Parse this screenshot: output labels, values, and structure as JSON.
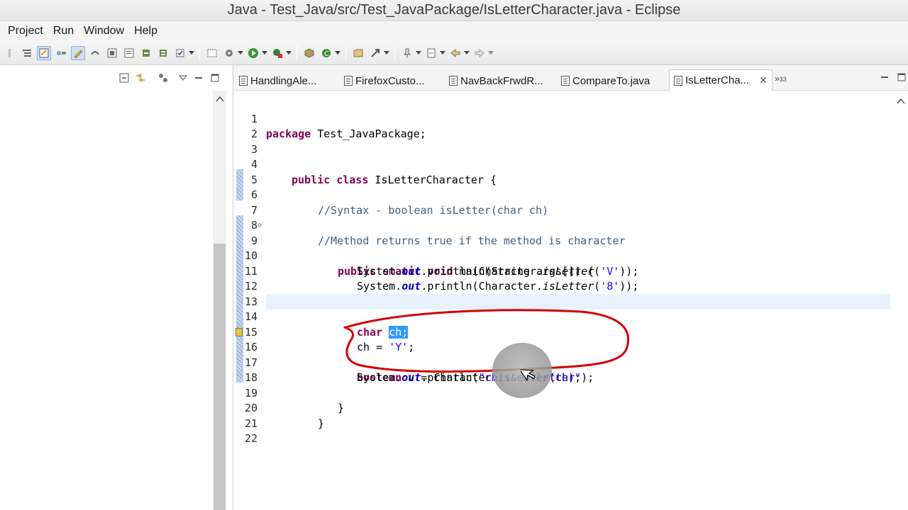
{
  "window": {
    "title": "Java - Test_Java/src/Test_JavaPackage/IsLetterCharacter.java - Eclipse"
  },
  "menu": [
    "Project",
    "Run",
    "Window",
    "Help"
  ],
  "editor": {
    "tabs": [
      {
        "label": "HandlingAle...",
        "active": false
      },
      {
        "label": "FirefoxCusto...",
        "active": false
      },
      {
        "label": "NavBackFrwdR...",
        "active": false
      },
      {
        "label": "CompareTo.java",
        "active": false
      },
      {
        "label": "IsLetterCha...",
        "active": true
      }
    ],
    "overflow_count": "33",
    "lines": [
      {
        "n": "1"
      },
      {
        "n": "2"
      },
      {
        "n": "3"
      },
      {
        "n": "4"
      },
      {
        "n": "5"
      },
      {
        "n": "6"
      },
      {
        "n": "7"
      },
      {
        "n": "8"
      },
      {
        "n": "9"
      },
      {
        "n": "10"
      },
      {
        "n": "11"
      },
      {
        "n": "12"
      },
      {
        "n": "13"
      },
      {
        "n": "14"
      },
      {
        "n": "15"
      },
      {
        "n": "16"
      },
      {
        "n": "17"
      },
      {
        "n": "18"
      },
      {
        "n": "19"
      },
      {
        "n": "20"
      },
      {
        "n": "21"
      },
      {
        "n": "22"
      }
    ],
    "code": {
      "l1_kw": "package",
      "l1_rest": " Test_JavaPackage;",
      "l4_kw": "public class",
      "l4_rest": " IsLetterCharacter {",
      "l6": "//Syntax - boolean isLetter(char ch)",
      "l8": "//Method returns true if the method is character",
      "l9_kw": "public static void",
      "l9_rest": " main(String args[]) {",
      "l10_a": "System.",
      "l10_out": "out",
      "l10_b": ".println(Character.",
      "l10_m": "isLetter",
      "l10_c": "(",
      "l10_s": "'V'",
      "l10_d": "));",
      "l11_a": "System.",
      "l11_out": "out",
      "l11_b": ".println(Character.",
      "l11_m": "isLetter",
      "l11_c": "(",
      "l11_s": "'8'",
      "l11_d": "));",
      "l14_kw": "char",
      "l14_sel": "ch;",
      "l15_a": "ch = ",
      "l15_s": "'Y'",
      "l15_b": ";",
      "l16_kw": "boolean",
      "l16_a": " v = Character.",
      "l16_m": "isLetter",
      "l16_b": "(ch);",
      "l17_a": "System.",
      "l17_out": "out",
      "l17_b": ".println(",
      "l17_s": "\"ch is a letter\"",
      "l17_c": ");",
      "l19": "}",
      "l20": "}"
    }
  },
  "colors": {
    "keyword": "#7f0055",
    "comment": "#3f5f7f",
    "string": "#2a00ff",
    "field": "#0000c0",
    "selection": "#3399ff",
    "annotation": "#d40000"
  }
}
